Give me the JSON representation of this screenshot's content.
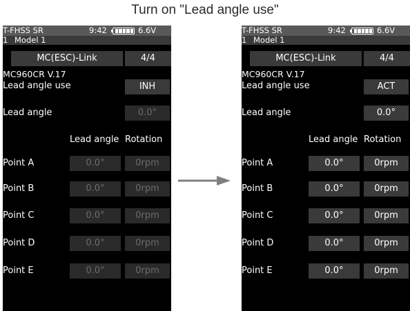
{
  "caption": "Turn on \"Lead angle use\"",
  "screens": [
    {
      "status": {
        "system": "T-FHSS SR",
        "time": "9:42",
        "voltage": "6.6V"
      },
      "model": {
        "number": "1",
        "name": "Model 1"
      },
      "title": "MC(ESC)-Link",
      "page": "4/4",
      "version": "MC960CR V.17",
      "lead_angle_use_label": "Lead angle use",
      "lead_angle_use_value": "INH",
      "lead_angle_label": "Lead angle",
      "lead_angle_value": "0.0°",
      "col_lead_angle": "Lead angle",
      "col_rotation": "Rotation",
      "points": [
        {
          "name": "Point A",
          "angle": "0.0°",
          "rotation": "0rpm"
        },
        {
          "name": "Point B",
          "angle": "0.0°",
          "rotation": "0rpm"
        },
        {
          "name": "Point C",
          "angle": "0.0°",
          "rotation": "0rpm"
        },
        {
          "name": "Point D",
          "angle": "0.0°",
          "rotation": "0rpm"
        },
        {
          "name": "Point E",
          "angle": "0.0°",
          "rotation": "0rpm"
        }
      ]
    },
    {
      "status": {
        "system": "T-FHSS SR",
        "time": "9:42",
        "voltage": "6.6V"
      },
      "model": {
        "number": "1",
        "name": "Model 1"
      },
      "title": "MC(ESC)-Link",
      "page": "4/4",
      "version": "MC960CR V.17",
      "lead_angle_use_label": "Lead angle use",
      "lead_angle_use_value": "ACT",
      "lead_angle_label": "Lead angle",
      "lead_angle_value": "0.0°",
      "col_lead_angle": "Lead angle",
      "col_rotation": "Rotation",
      "points": [
        {
          "name": "Point A",
          "angle": "0.0°",
          "rotation": "0rpm"
        },
        {
          "name": "Point B",
          "angle": "0.0°",
          "rotation": "0rpm"
        },
        {
          "name": "Point C",
          "angle": "0.0°",
          "rotation": "0rpm"
        },
        {
          "name": "Point D",
          "angle": "0.0°",
          "rotation": "0rpm"
        },
        {
          "name": "Point E",
          "angle": "0.0°",
          "rotation": "0rpm"
        }
      ]
    }
  ],
  "icons": {
    "battery": "battery-icon",
    "arrow": "right-arrow-icon"
  },
  "colors": {
    "screen": "#000000",
    "field": "#3a3a3a",
    "disabled_text": "#6c6c6c",
    "arrow": "#808080"
  }
}
